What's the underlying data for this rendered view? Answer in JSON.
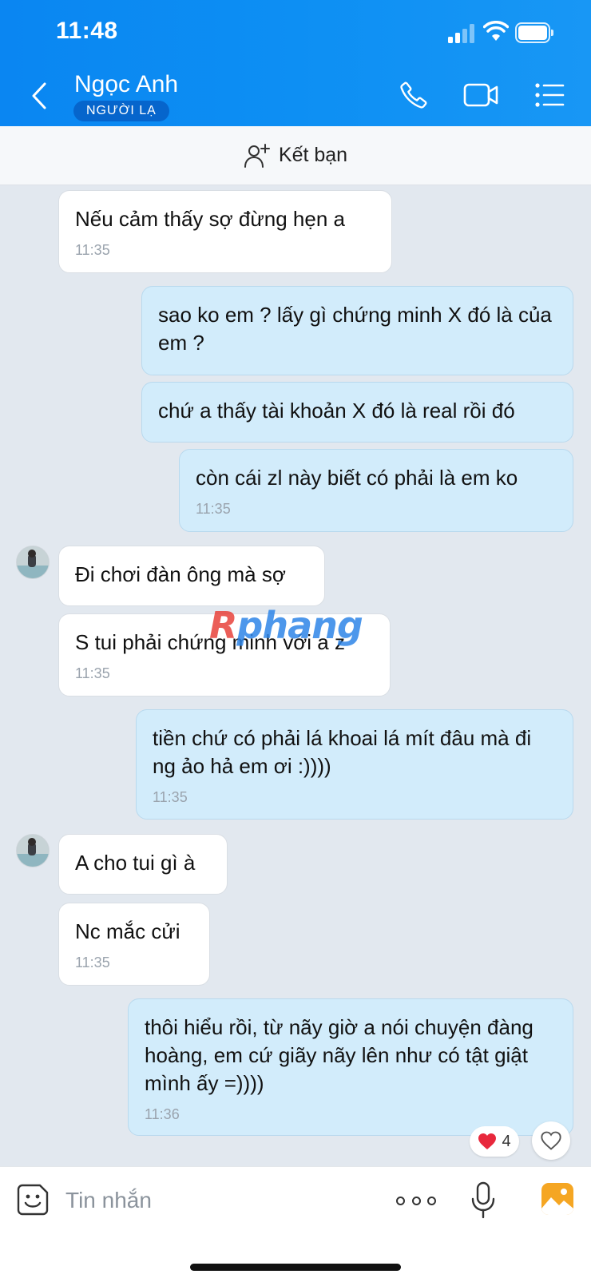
{
  "status_bar": {
    "time": "11:48"
  },
  "header": {
    "contact_name": "Ngọc Anh",
    "badge": "NGƯỜI LẠ",
    "icons": {
      "back": "chevron-left-icon",
      "call": "phone-icon",
      "video": "video-camera-icon",
      "menu": "list-menu-icon"
    }
  },
  "add_friend": {
    "label": "Kết bạn",
    "icon": "add-user-icon"
  },
  "messages": [
    {
      "side": "in",
      "text": "Nếu cảm thấy sợ đừng hẹn a",
      "time": "11:35"
    },
    {
      "side": "out",
      "text": "sao ko em ? lấy gì chứng minh X đó là của em ?",
      "time": ""
    },
    {
      "side": "out",
      "text": "chứ a thấy tài khoản X đó là real rồi đó",
      "time": ""
    },
    {
      "side": "out",
      "text": "còn cái zl này biết có phải là em ko",
      "time": "11:35"
    },
    {
      "side": "in",
      "text": "Đi chơi đàn ông mà sợ",
      "time": ""
    },
    {
      "side": "in",
      "text": "S tui phải chứng minh với a z",
      "time": "11:35"
    },
    {
      "side": "out",
      "text": "tiền chứ có phải lá khoai lá mít đâu mà đi ng ảo hả em ơi :))))",
      "time": "11:35"
    },
    {
      "side": "in",
      "text": "A cho tui gì à",
      "time": ""
    },
    {
      "side": "in",
      "text": "Nc mắc cửi",
      "time": "11:35"
    },
    {
      "side": "out",
      "text": "thôi hiểu rồi, từ nãy giờ a nói chuyện đàng hoàng, em cứ giãy nãy lên như có tật giật mình ấy =))))",
      "time": "11:36"
    }
  ],
  "watermark": {
    "first": "R",
    "rest": "phang"
  },
  "reaction": {
    "icon": "heart-icon",
    "color": "#e8283c",
    "count": "4"
  },
  "input": {
    "placeholder": "Tin nhắn"
  },
  "colors": {
    "header": "#0d8ff3",
    "outgoing_bubble": "#d2ecfb",
    "incoming_bubble": "#ffffff",
    "background": "#e2e8ef"
  }
}
